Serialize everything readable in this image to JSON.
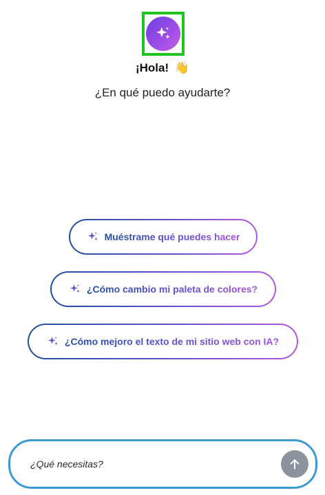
{
  "header": {
    "avatar_icon": "sparkle-icon",
    "greeting": "¡Hola!",
    "greeting_emoji": "👋",
    "subtitle": "¿En qué puedo ayudarte?"
  },
  "suggestions": [
    {
      "icon": "sparkle-icon",
      "label": "Muéstrame qué puedes hacer"
    },
    {
      "icon": "sparkle-icon",
      "label": "¿Cómo cambio mi paleta de colores?"
    },
    {
      "icon": "sparkle-icon",
      "label": "¿Cómo mejoro el texto de mi sitio web con IA?"
    }
  ],
  "input": {
    "placeholder": "¿Qué necesitas?",
    "value": "",
    "send_icon": "arrow-up-icon"
  },
  "colors": {
    "focus_outline": "#1fc21f",
    "avatar_gradient_start": "#6b3fe0",
    "avatar_gradient_end": "#c45be8",
    "chip_gradient_start": "#1f4ea5",
    "chip_gradient_end": "#b356e0",
    "input_border": "#3b9ad3",
    "send_button": "#8a939e"
  }
}
